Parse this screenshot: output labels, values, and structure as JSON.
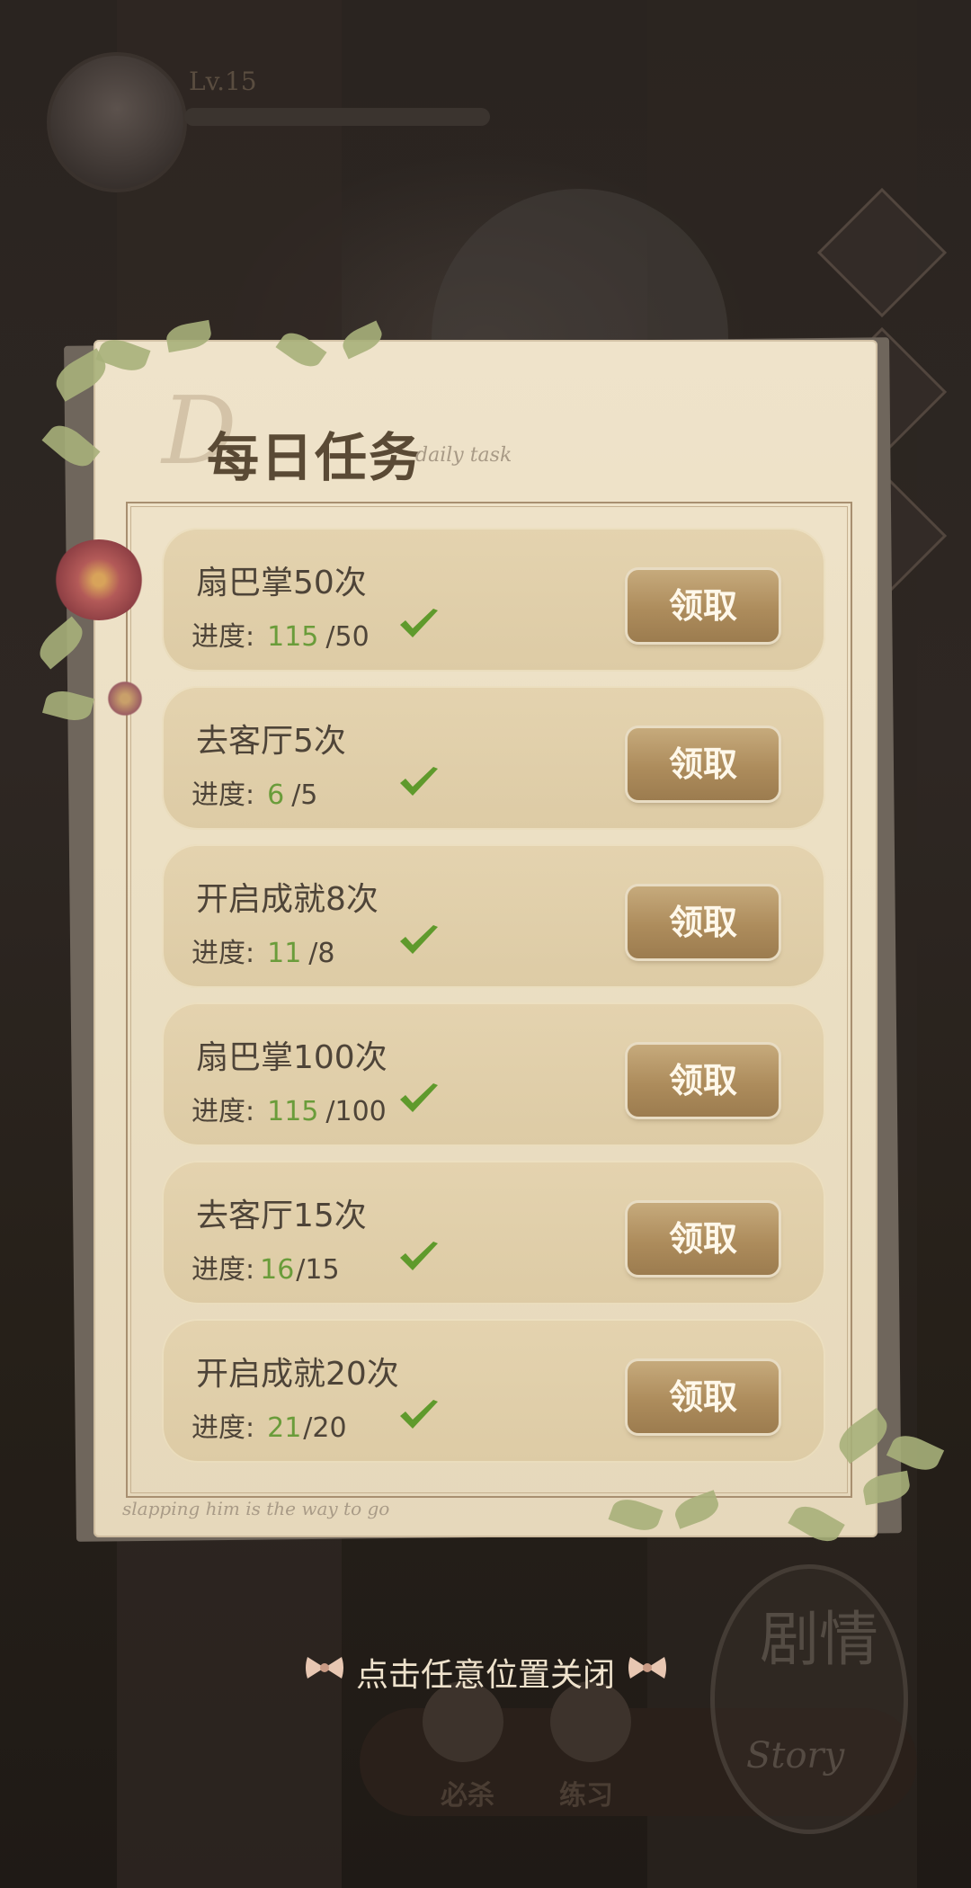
{
  "background": {
    "level_label": "Lv.15",
    "bottom_buttons": [
      {
        "label": "必杀",
        "icon": "heart-fist-icon"
      },
      {
        "label": "练习",
        "icon": "fist-icon"
      }
    ],
    "story_badge": {
      "label_cn": "剧情",
      "label_en": "Story"
    }
  },
  "panel": {
    "title_script_letter": "D",
    "title": "每日任务",
    "subtitle": "daily task",
    "footer": "slapping him is the way to go",
    "progress_label": "进度:",
    "claim_label": "领取",
    "tasks": [
      {
        "name": "扇巴掌50次",
        "current": "115",
        "target": "/50"
      },
      {
        "name": "去客厅5次",
        "current": "6",
        "target": "/5"
      },
      {
        "name": "开启成就8次",
        "current": "11",
        "target": "/8"
      },
      {
        "name": "扇巴掌100次",
        "current": "115",
        "target": "/100"
      },
      {
        "name": "去客厅15次",
        "current": "16",
        "target": "/15"
      },
      {
        "name": "开启成就20次",
        "current": "21",
        "target": "/20"
      }
    ]
  },
  "close_hint": "点击任意位置关闭",
  "colors": {
    "progress_current": "#6a9c3a",
    "check": "#5f9a2c",
    "button": "#ad8c5c"
  }
}
